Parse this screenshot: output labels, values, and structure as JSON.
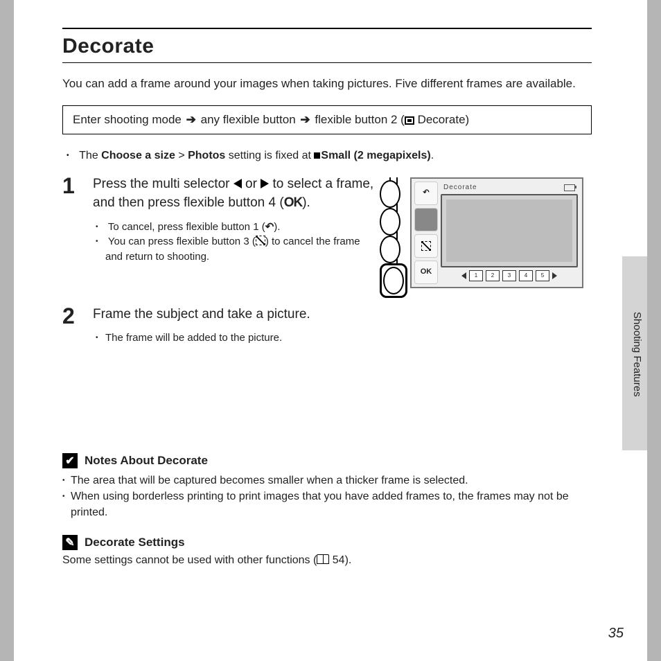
{
  "title": "Decorate",
  "intro": "You can add a frame around your images when taking pictures. Five different frames are available.",
  "path": {
    "p1": "Enter shooting mode",
    "p2": "any flexible button",
    "p3": "flexible button 2 (",
    "p4": " Decorate)"
  },
  "setting_line": {
    "pre": "The ",
    "b1": "Choose a size",
    "gt": " > ",
    "b2": "Photos",
    "mid": " setting is fixed at ",
    "b3": "Small (2 megapixels)",
    "post": "."
  },
  "steps": [
    {
      "num": "1",
      "text_a": "Press the multi selector ",
      "text_b": " or ",
      "text_c": " to select a frame, and then press flexible button 4 (",
      "text_d": ").",
      "sub": [
        {
          "a": "To cancel, press flexible button 1 (",
          "b": ")."
        },
        {
          "a": "You can press flexible button 3 (",
          "b": ") to cancel the frame and return to shooting."
        }
      ]
    },
    {
      "num": "2",
      "text_a": "Frame the subject and take a picture.",
      "sub": [
        {
          "a": "The frame will be added to the picture."
        }
      ]
    }
  ],
  "screen": {
    "title": "Decorate",
    "ok": "OK",
    "thumbs": [
      "1",
      "2",
      "3",
      "4",
      "5"
    ]
  },
  "notes": {
    "heading": "Notes About Decorate",
    "items": [
      "The area that will be captured becomes smaller when a thicker frame is selected.",
      "When using borderless printing to print images that you have added frames to, the frames may not be printed."
    ]
  },
  "settings": {
    "heading": "Decorate Settings",
    "text_a": "Some settings cannot be used with other functions (",
    "text_b": " 54)."
  },
  "side_label": "Shooting Features",
  "page_number": "35"
}
